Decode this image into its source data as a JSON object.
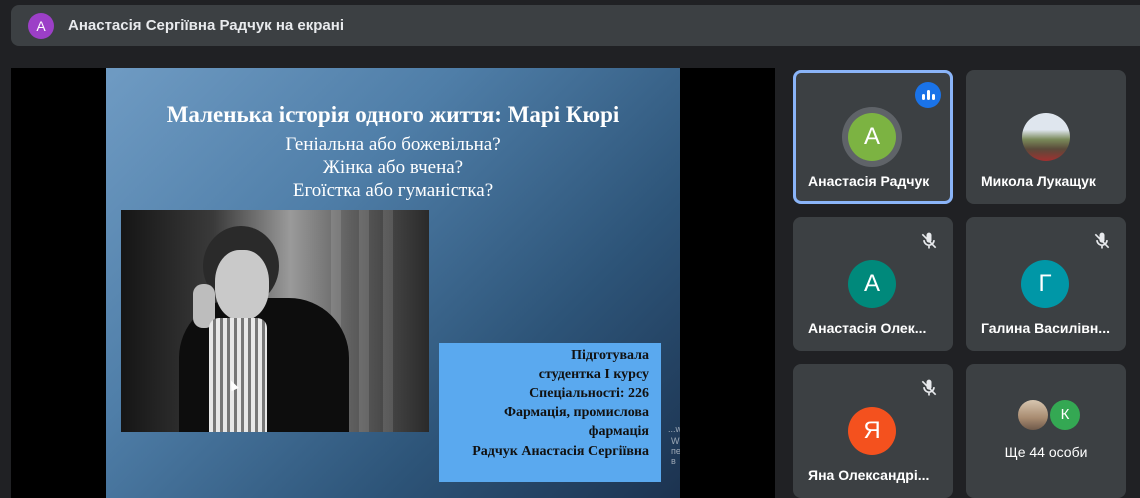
{
  "header": {
    "avatar_letter": "А",
    "presenting_title": "Анастасія Сергіївна Радчук на екрані"
  },
  "slide": {
    "title": "Маленька історія одного життя: Марі Кюрі",
    "lines": [
      "Геніальна або божевільна?",
      "Жінка або вчена?",
      "Егоїстка або гуманістка?"
    ],
    "credits": [
      "Підготувала",
      "студентка І курсу",
      "Спеціальності: 226",
      "Фармація, промислова",
      "фармація",
      "Радчук Анастасія Сергіївна"
    ],
    "watermark_1": "...ws",
    "watermark_2": "Windows, перейдите в"
  },
  "participants": [
    {
      "name": "Анастасія Радчук",
      "initial": "А",
      "color": "#7cb342",
      "speaking": true
    },
    {
      "name": "Микола Лукащук",
      "initial": "",
      "photo": true
    },
    {
      "name": "Анастасія Олек...",
      "initial": "А",
      "color": "#00897b",
      "muted": true
    },
    {
      "name": "Галина Василівн...",
      "initial": "Г",
      "color": "#0097a7",
      "muted": true
    },
    {
      "name": "Яна Олександрі...",
      "initial": "Я",
      "color": "#f4511e",
      "muted": true
    },
    {
      "more_label": "Ще 44 особи",
      "initial": "К",
      "color": "#34a853"
    }
  ]
}
